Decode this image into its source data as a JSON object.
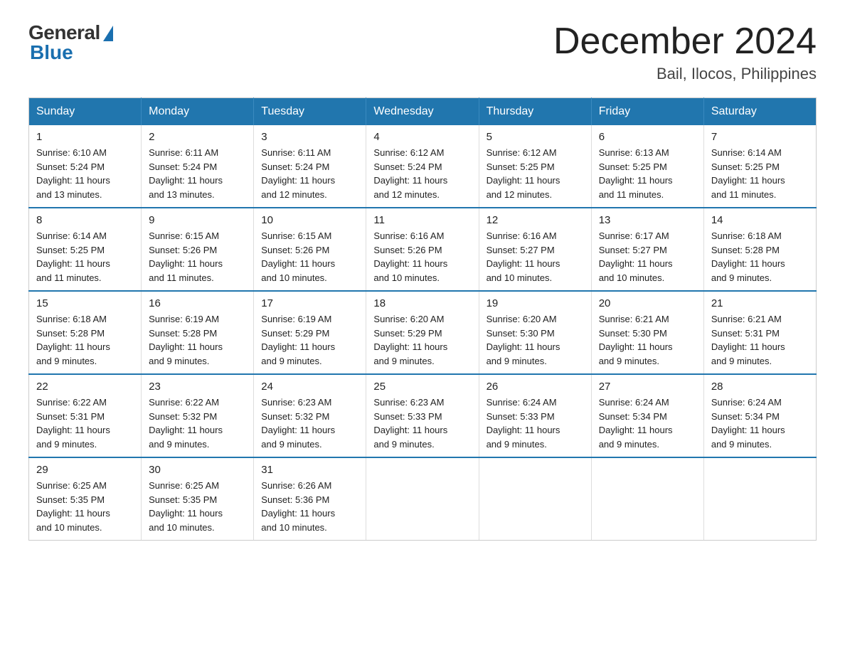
{
  "logo": {
    "general": "General",
    "blue": "Blue"
  },
  "header": {
    "month_title": "December 2024",
    "location": "Bail, Ilocos, Philippines"
  },
  "days_of_week": [
    "Sunday",
    "Monday",
    "Tuesday",
    "Wednesday",
    "Thursday",
    "Friday",
    "Saturday"
  ],
  "weeks": [
    [
      {
        "day": "1",
        "sunrise": "6:10 AM",
        "sunset": "5:24 PM",
        "daylight": "11 hours and 13 minutes."
      },
      {
        "day": "2",
        "sunrise": "6:11 AM",
        "sunset": "5:24 PM",
        "daylight": "11 hours and 13 minutes."
      },
      {
        "day": "3",
        "sunrise": "6:11 AM",
        "sunset": "5:24 PM",
        "daylight": "11 hours and 12 minutes."
      },
      {
        "day": "4",
        "sunrise": "6:12 AM",
        "sunset": "5:24 PM",
        "daylight": "11 hours and 12 minutes."
      },
      {
        "day": "5",
        "sunrise": "6:12 AM",
        "sunset": "5:25 PM",
        "daylight": "11 hours and 12 minutes."
      },
      {
        "day": "6",
        "sunrise": "6:13 AM",
        "sunset": "5:25 PM",
        "daylight": "11 hours and 11 minutes."
      },
      {
        "day": "7",
        "sunrise": "6:14 AM",
        "sunset": "5:25 PM",
        "daylight": "11 hours and 11 minutes."
      }
    ],
    [
      {
        "day": "8",
        "sunrise": "6:14 AM",
        "sunset": "5:25 PM",
        "daylight": "11 hours and 11 minutes."
      },
      {
        "day": "9",
        "sunrise": "6:15 AM",
        "sunset": "5:26 PM",
        "daylight": "11 hours and 11 minutes."
      },
      {
        "day": "10",
        "sunrise": "6:15 AM",
        "sunset": "5:26 PM",
        "daylight": "11 hours and 10 minutes."
      },
      {
        "day": "11",
        "sunrise": "6:16 AM",
        "sunset": "5:26 PM",
        "daylight": "11 hours and 10 minutes."
      },
      {
        "day": "12",
        "sunrise": "6:16 AM",
        "sunset": "5:27 PM",
        "daylight": "11 hours and 10 minutes."
      },
      {
        "day": "13",
        "sunrise": "6:17 AM",
        "sunset": "5:27 PM",
        "daylight": "11 hours and 10 minutes."
      },
      {
        "day": "14",
        "sunrise": "6:18 AM",
        "sunset": "5:28 PM",
        "daylight": "11 hours and 9 minutes."
      }
    ],
    [
      {
        "day": "15",
        "sunrise": "6:18 AM",
        "sunset": "5:28 PM",
        "daylight": "11 hours and 9 minutes."
      },
      {
        "day": "16",
        "sunrise": "6:19 AM",
        "sunset": "5:28 PM",
        "daylight": "11 hours and 9 minutes."
      },
      {
        "day": "17",
        "sunrise": "6:19 AM",
        "sunset": "5:29 PM",
        "daylight": "11 hours and 9 minutes."
      },
      {
        "day": "18",
        "sunrise": "6:20 AM",
        "sunset": "5:29 PM",
        "daylight": "11 hours and 9 minutes."
      },
      {
        "day": "19",
        "sunrise": "6:20 AM",
        "sunset": "5:30 PM",
        "daylight": "11 hours and 9 minutes."
      },
      {
        "day": "20",
        "sunrise": "6:21 AM",
        "sunset": "5:30 PM",
        "daylight": "11 hours and 9 minutes."
      },
      {
        "day": "21",
        "sunrise": "6:21 AM",
        "sunset": "5:31 PM",
        "daylight": "11 hours and 9 minutes."
      }
    ],
    [
      {
        "day": "22",
        "sunrise": "6:22 AM",
        "sunset": "5:31 PM",
        "daylight": "11 hours and 9 minutes."
      },
      {
        "day": "23",
        "sunrise": "6:22 AM",
        "sunset": "5:32 PM",
        "daylight": "11 hours and 9 minutes."
      },
      {
        "day": "24",
        "sunrise": "6:23 AM",
        "sunset": "5:32 PM",
        "daylight": "11 hours and 9 minutes."
      },
      {
        "day": "25",
        "sunrise": "6:23 AM",
        "sunset": "5:33 PM",
        "daylight": "11 hours and 9 minutes."
      },
      {
        "day": "26",
        "sunrise": "6:24 AM",
        "sunset": "5:33 PM",
        "daylight": "11 hours and 9 minutes."
      },
      {
        "day": "27",
        "sunrise": "6:24 AM",
        "sunset": "5:34 PM",
        "daylight": "11 hours and 9 minutes."
      },
      {
        "day": "28",
        "sunrise": "6:24 AM",
        "sunset": "5:34 PM",
        "daylight": "11 hours and 9 minutes."
      }
    ],
    [
      {
        "day": "29",
        "sunrise": "6:25 AM",
        "sunset": "5:35 PM",
        "daylight": "11 hours and 10 minutes."
      },
      {
        "day": "30",
        "sunrise": "6:25 AM",
        "sunset": "5:35 PM",
        "daylight": "11 hours and 10 minutes."
      },
      {
        "day": "31",
        "sunrise": "6:26 AM",
        "sunset": "5:36 PM",
        "daylight": "11 hours and 10 minutes."
      },
      null,
      null,
      null,
      null
    ]
  ],
  "labels": {
    "sunrise": "Sunrise:",
    "sunset": "Sunset:",
    "daylight": "Daylight:"
  }
}
